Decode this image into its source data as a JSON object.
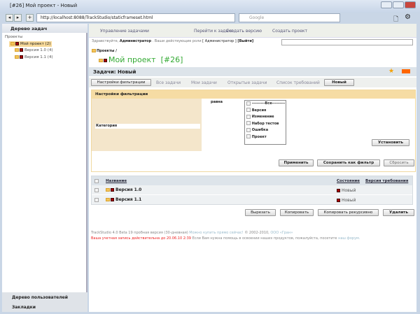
{
  "window": {
    "title": "[#26] Мой проект - Новый"
  },
  "browser": {
    "url": "http://localhost:8088/TrackStudio/staticframeset.html",
    "search_placeholder": "Google"
  },
  "left": {
    "header": "Дерево задач",
    "root": "Проекты",
    "items": [
      {
        "label": "Мой проект (2)"
      },
      {
        "label": "Версия 1.0 (4)"
      },
      {
        "label": "Версия 1.1 (4)"
      }
    ],
    "bottom": [
      "Дерево пользователей",
      "Закладки"
    ]
  },
  "toolbar": {
    "manage": "Управление задачами",
    "goto": "Перейти к задаче",
    "create_version": "Создать версию",
    "create_project": "Создать проект"
  },
  "greeting": {
    "hello": "Здравствуйте,",
    "user": "Администратор",
    "roles_label": ". Ваши действующие роли",
    "role": "[ Администратор ]",
    "logout": "[Выйти]"
  },
  "breadcrumb": "Проекты /",
  "task": {
    "title": "Мой проект",
    "number": "[#26]"
  },
  "section": {
    "title": "Задачи: Новый"
  },
  "tabs": [
    "Настройки фильтрации",
    "Все задачи",
    "Мои задачи",
    "Открытые задачи",
    "Список требований",
    "Новый"
  ],
  "filter": {
    "header": "Настройки фильтрации",
    "field": "Категория",
    "operator": "равна",
    "options": [
      "---------Все---------",
      "Версия",
      "Изменение",
      "Набор тестов",
      "Ошибка",
      "Проект"
    ],
    "set": "Установить",
    "apply": "Применить",
    "save": "Сохранить как фильтр",
    "reset": "Сбросить"
  },
  "table": {
    "columns": [
      "Название",
      "Состояние",
      "Версия требования"
    ],
    "rows": [
      {
        "name": "Версия 1.0",
        "state": "Новый"
      },
      {
        "name": "Версия 1.1",
        "state": "Новый"
      }
    ]
  },
  "actions": [
    "Вырезать",
    "Копировать",
    "Копировать рекурсивно",
    "Удалить"
  ],
  "footer": {
    "line1": "TrackStudio 4.0 Beta 19 пробная версия (30-дневная)",
    "buy": "Можно купить прямо сейчас!",
    "copy": "© 2002-2010,",
    "company": "ООО «Гран»",
    "line2_red": "Ваша учетная запись действительна до 20.06.10 2:39",
    "line2": "Если Вам нужна помощь в освоении наших продуктов, пожалуйста, посетите",
    "forum": "наш форум."
  }
}
